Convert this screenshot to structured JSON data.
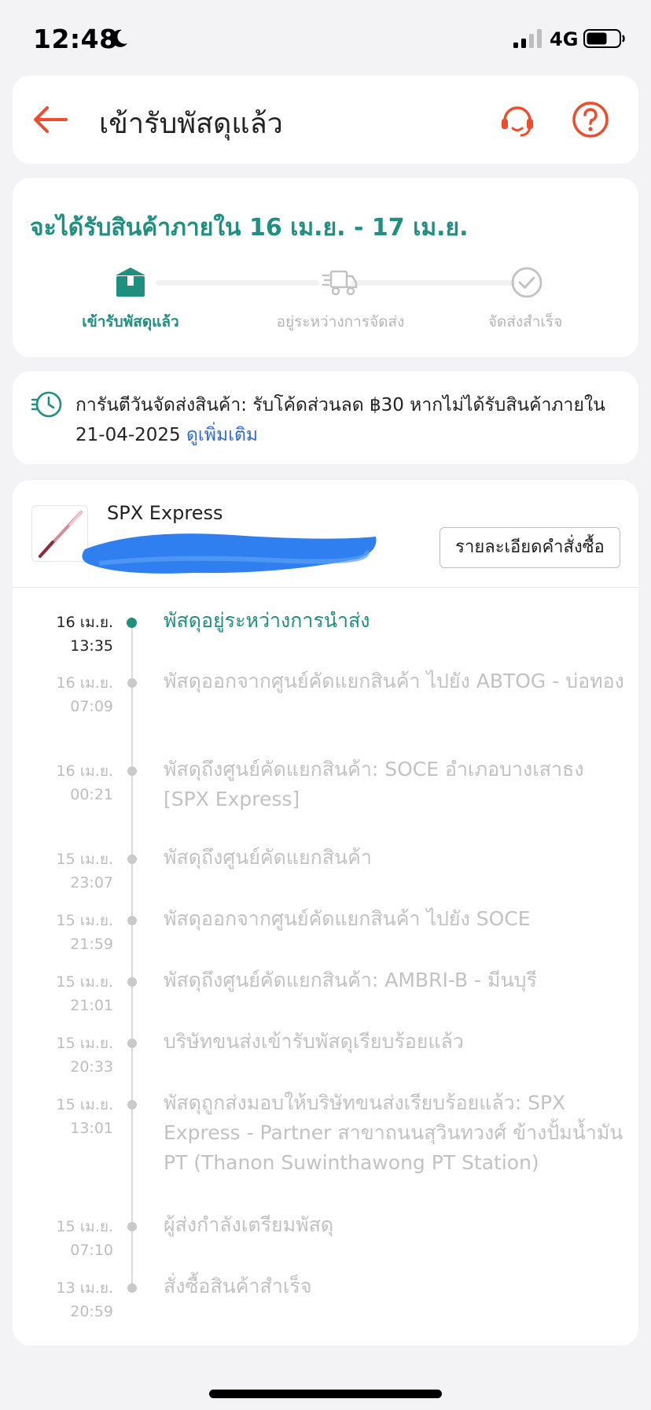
{
  "status_bar": {
    "time": "12:48",
    "network": "4G",
    "icons": [
      "moon-icon",
      "signal-icon",
      "battery-icon"
    ]
  },
  "header": {
    "title": "เข้ารับพัสดุแล้ว",
    "icons": [
      "back-arrow-icon",
      "customer-support-icon",
      "help-icon"
    ]
  },
  "delivery": {
    "estimate": "จะได้รับสินค้าภายใน 16 เม.ย. - 17 เม.ย.",
    "steps": [
      {
        "label": "เข้ารับพัสดุแล้ว",
        "icon": "package-icon",
        "active": true
      },
      {
        "label": "อยู่ระหว่างการจัดส่ง",
        "icon": "truck-icon",
        "active": false
      },
      {
        "label": "จัดส่งสำเร็จ",
        "icon": "check-circle-icon",
        "active": false
      }
    ]
  },
  "guarantee": {
    "text": "การันตีวันจัดส่งสินค้า: รับโค้ดส่วนลด ฿30 หากไม่ได้รับสินค้าภายใน 21-04-2025 ",
    "link": "ดูเพิ่มเติม",
    "icon": "clock-icon"
  },
  "shipment": {
    "carrier": "SPX Express",
    "order_button": "รายละเอียดคำสั่งซื้อ"
  },
  "timeline": [
    {
      "date": "16 เม.ย.",
      "time": "13:35",
      "desc": "พัสดุอยู่ระหว่างการนำส่ง",
      "active": true
    },
    {
      "date": "16 เม.ย.",
      "time": "07:09",
      "desc": "พัสดุออกจากศูนย์คัดแยกสินค้า ไปยัง ABTOG - บ่อทอง",
      "active": false
    },
    {
      "date": "16 เม.ย.",
      "time": "00:21",
      "desc": "พัสดุถึงศูนย์คัดแยกสินค้า: SOCE อำเภอบางเสาธง [SPX Express]",
      "active": false
    },
    {
      "date": "15 เม.ย.",
      "time": "23:07",
      "desc": "พัสดุถึงศูนย์คัดแยกสินค้า",
      "active": false
    },
    {
      "date": "15 เม.ย.",
      "time": "21:59",
      "desc": "พัสดุออกจากศูนย์คัดแยกสินค้า ไปยัง SOCE",
      "active": false
    },
    {
      "date": "15 เม.ย.",
      "time": "21:01",
      "desc": "พัสดุถึงศูนย์คัดแยกสินค้า: AMBRI-B - มีนบุรี",
      "active": false
    },
    {
      "date": "15 เม.ย.",
      "time": "20:33",
      "desc": "บริษัทขนส่งเข้ารับพัสดุเรียบร้อยแล้ว",
      "active": false
    },
    {
      "date": "15 เม.ย.",
      "time": "13:01",
      "desc": "พัสดุถูกส่งมอบให้บริษัทขนส่งเรียบร้อยแล้ว: SPX Express - Partner สาขาถนนสุวินทวงศ์ ข้างปั้มน้ำมัน PT (Thanon Suwinthawong PT Station)",
      "active": false
    },
    {
      "date": "15 เม.ย.",
      "time": "07:10",
      "desc": " ผู้ส่งกำลังเตรียมพัสดุ",
      "active": false
    },
    {
      "date": "13 เม.ย.",
      "time": "20:59",
      "desc": "สั่งซื้อสินค้าสำเร็จ",
      "active": false
    }
  ]
}
